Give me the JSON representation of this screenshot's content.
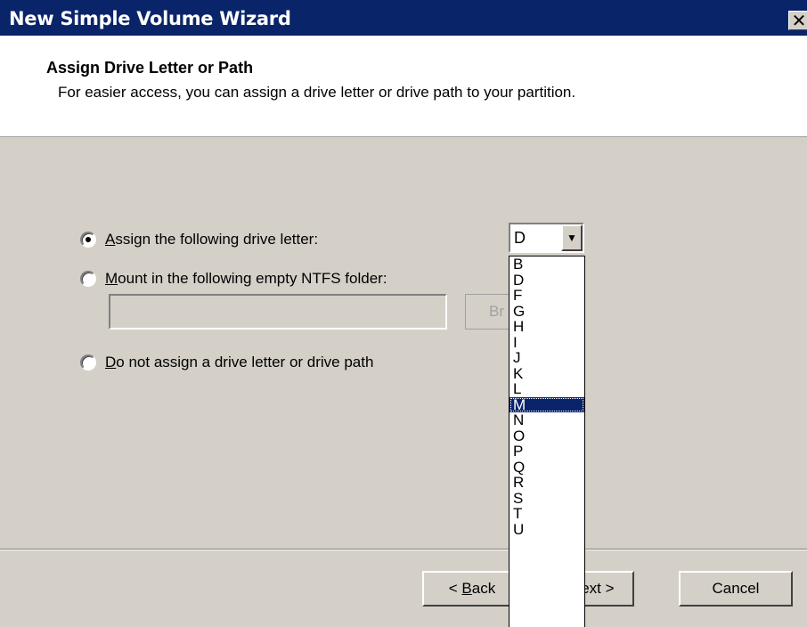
{
  "window": {
    "title": "New Simple Volume Wizard",
    "close_glyph": "✕"
  },
  "header": {
    "title": "Assign Drive Letter or Path",
    "subtitle": "For easier access, you can assign a drive letter or drive path to your partition."
  },
  "options": {
    "assign_letter": {
      "label_first": "A",
      "label_rest": "ssign the following drive letter:",
      "checked": true
    },
    "mount_folder": {
      "label_first": "M",
      "label_rest": "ount in the following empty NTFS folder:",
      "checked": false
    },
    "no_assign": {
      "label_first": "D",
      "label_rest": "o not assign a drive letter or drive path",
      "checked": false
    }
  },
  "path_input": {
    "value": ""
  },
  "browse_button": {
    "label": "Br"
  },
  "drive_combo": {
    "value": "D",
    "arrow_glyph": "▼"
  },
  "dropdown": {
    "items": [
      "B",
      "D",
      "F",
      "G",
      "H",
      "I",
      "J",
      "K",
      "L",
      "M",
      "N",
      "O",
      "P",
      "Q",
      "R",
      "S",
      "T",
      "U"
    ],
    "selected": "M"
  },
  "buttons": {
    "back": {
      "prefix": "< ",
      "underlined": "B",
      "rest": "ack"
    },
    "next": {
      "label": "lext >"
    },
    "cancel": {
      "label": "Cancel"
    }
  },
  "colors": {
    "titlebar": "#0a246a",
    "dialog_bg": "#d4d0c8",
    "selection": "#0a246a"
  }
}
